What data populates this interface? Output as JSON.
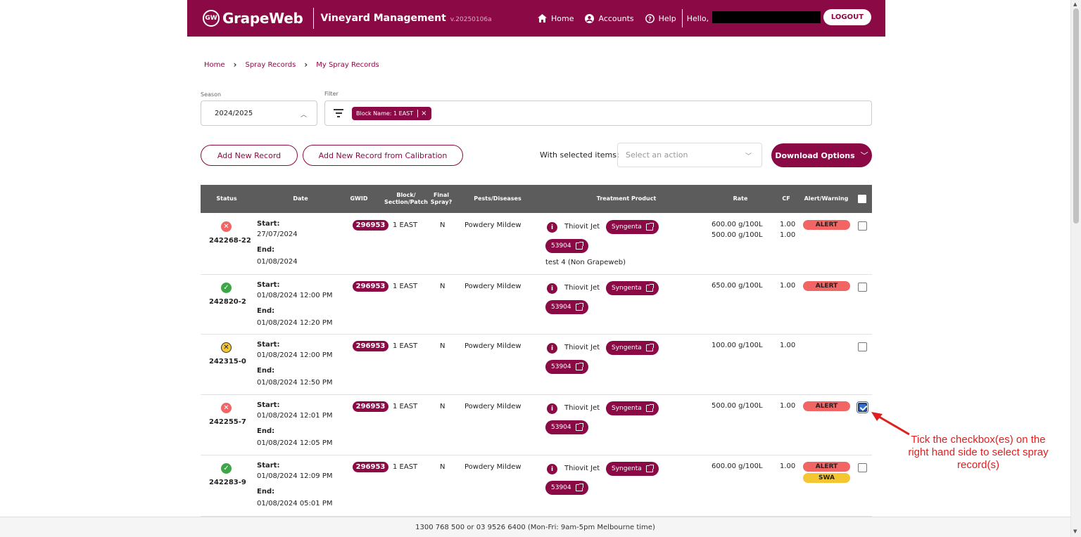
{
  "header": {
    "logo_text": "GrapeWeb",
    "logo_mark": "GW",
    "app_title": "Vineyard Management",
    "version": "v.20250106a",
    "nav": [
      {
        "label": "Home",
        "icon": "home-icon"
      },
      {
        "label": "Accounts",
        "icon": "account-icon"
      },
      {
        "label": "Help",
        "icon": "help-icon"
      }
    ],
    "hello": "Hello,",
    "logout": "LOGOUT"
  },
  "breadcrumb": [
    "Home",
    "Spray Records",
    "My Spray Records"
  ],
  "season": {
    "label": "Season",
    "value": "2024/2025"
  },
  "filter": {
    "label": "Filter",
    "chip": "Block Name: 1 EAST"
  },
  "actions": {
    "add_new": "Add New Record",
    "add_from_calibration": "Add New Record from Calibration",
    "with_selected": "With selected items:",
    "select_placeholder": "Select an action",
    "download": "Download Options"
  },
  "table": {
    "columns": [
      "Status",
      "Date",
      "GWID",
      "Block/\nSection/Patch",
      "Final\nSpray?",
      "Pests/Diseases",
      "Treatment Product",
      "Rate",
      "CF",
      "Alert/Warning"
    ],
    "rows": [
      {
        "status": "red",
        "status_symbol": "✕",
        "id": "242268-22",
        "start_label": "Start:",
        "start": "27/07/2024",
        "end_label": "End:",
        "end": "01/08/2024",
        "gwid": "296953",
        "block": "1 EAST",
        "final": "N",
        "pest": "Powdery Mildew",
        "product": "Thiovit Jet",
        "supplier": "Syngenta",
        "code": "53904",
        "extra": "test 4  (Non Grapeweb)",
        "rates": [
          "600.00 g/100L",
          "500.00 g/100L"
        ],
        "cfs": [
          "1.00",
          "1.00"
        ],
        "badges": [
          "ALERT"
        ],
        "checked": false
      },
      {
        "status": "green",
        "status_symbol": "✓",
        "id": "242820-2",
        "start_label": "Start:",
        "start": "01/08/2024 12:00 PM",
        "end_label": "End:",
        "end": "01/08/2024 12:20 PM",
        "gwid": "296953",
        "block": "1 EAST",
        "final": "N",
        "pest": "Powdery Mildew",
        "product": "Thiovit Jet",
        "supplier": "Syngenta",
        "code": "53904",
        "extra": "",
        "rates": [
          "650.00 g/100L"
        ],
        "cfs": [
          "1.00"
        ],
        "badges": [
          "ALERT"
        ],
        "checked": false
      },
      {
        "status": "yellow",
        "status_symbol": "✕",
        "id": "242315-0",
        "start_label": "Start:",
        "start": "01/08/2024 12:00 PM",
        "end_label": "End:",
        "end": "01/08/2024 12:50 PM",
        "gwid": "296953",
        "block": "1 EAST",
        "final": "N",
        "pest": "Powdery Mildew",
        "product": "Thiovit Jet",
        "supplier": "Syngenta",
        "code": "53904",
        "extra": "",
        "rates": [
          "100.00 g/100L"
        ],
        "cfs": [
          "1.00"
        ],
        "badges": [],
        "checked": false
      },
      {
        "status": "red",
        "status_symbol": "✕",
        "id": "242255-7",
        "start_label": "Start:",
        "start": "01/08/2024 12:01 PM",
        "end_label": "End:",
        "end": "01/08/2024 12:05 PM",
        "gwid": "296953",
        "block": "1 EAST",
        "final": "N",
        "pest": "Powdery Mildew",
        "product": "Thiovit Jet",
        "supplier": "Syngenta",
        "code": "53904",
        "extra": "",
        "rates": [
          "500.00 g/100L"
        ],
        "cfs": [
          "1.00"
        ],
        "badges": [
          "ALERT"
        ],
        "checked": true
      },
      {
        "status": "green",
        "status_symbol": "✓",
        "id": "242283-9",
        "start_label": "Start:",
        "start": "01/08/2024 12:09 PM",
        "end_label": "End:",
        "end": "01/08/2024 05:01 PM",
        "gwid": "296953",
        "block": "1 EAST",
        "final": "N",
        "pest": "Powdery Mildew",
        "product": "Thiovit Jet",
        "supplier": "Syngenta",
        "code": "53904",
        "extra": "",
        "rates": [
          "600.00 g/100L"
        ],
        "cfs": [
          "1.00"
        ],
        "badges": [
          "ALERT",
          "SWA"
        ],
        "checked": false
      }
    ]
  },
  "annotation": "Tick the checkbox(es) on the right hand side to select spray record(s)",
  "footer": "1300 768 500 or 03 9526 6400 (Mon-Fri: 9am-5pm Melbourne time)",
  "colors": {
    "brand": "#8b0a46",
    "alert": "#f26565",
    "swa": "#f3c632",
    "ok": "#3da747"
  }
}
